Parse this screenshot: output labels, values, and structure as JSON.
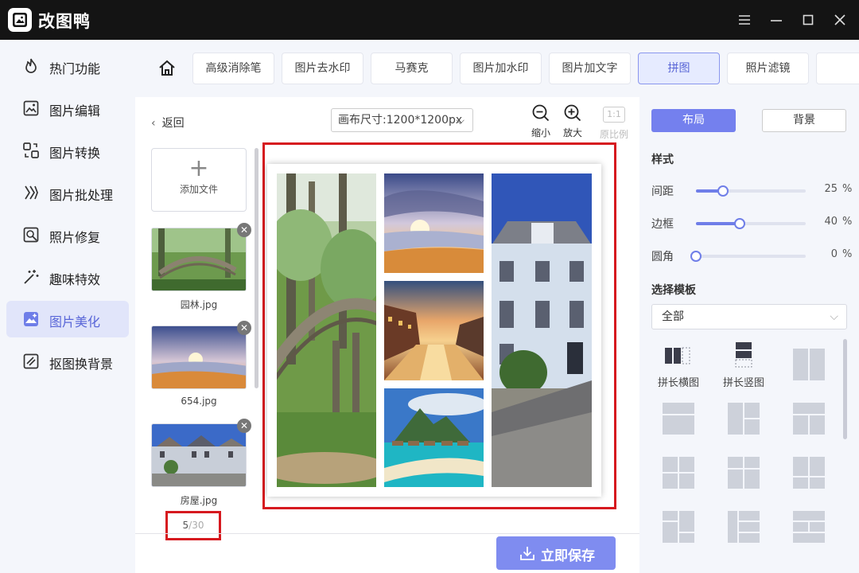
{
  "app": {
    "title": "改图鸭"
  },
  "sidebar": {
    "items": [
      {
        "label": "热门功能",
        "icon": "flame-icon"
      },
      {
        "label": "图片编辑",
        "icon": "image-edit-icon"
      },
      {
        "label": "图片转换",
        "icon": "convert-icon"
      },
      {
        "label": "图片批处理",
        "icon": "batch-icon"
      },
      {
        "label": "照片修复",
        "icon": "photo-repair-icon"
      },
      {
        "label": "趣味特效",
        "icon": "magic-wand-icon"
      },
      {
        "label": "图片美化",
        "icon": "beautify-icon",
        "active": true
      },
      {
        "label": "抠图换背景",
        "icon": "cutout-icon"
      }
    ]
  },
  "toolbar": {
    "tabs": [
      "高级消除笔",
      "图片去水印",
      "马赛克",
      "图片加水印",
      "图片加文字",
      "拼图",
      "照片滤镜"
    ],
    "active_tab": "拼图"
  },
  "workspace": {
    "back_label": "返回",
    "canvas_size": "画布尺寸:1200*1200px",
    "zoom_out_label": "缩小",
    "zoom_in_label": "放大",
    "ratio_badge": "1:1",
    "ratio_label": "原比例",
    "add_file_label": "添加文件",
    "files": [
      {
        "name": "园林.jpg"
      },
      {
        "name": "654.jpg"
      },
      {
        "name": "房屋.jpg"
      }
    ],
    "counter_current": "5",
    "counter_total": "/30",
    "save_label": "立即保存"
  },
  "right_panel": {
    "tabs": [
      "布局",
      "背景"
    ],
    "style_title": "样式",
    "sliders": [
      {
        "label": "间距",
        "value": "25",
        "unit": "%",
        "fraction": 0.25
      },
      {
        "label": "边框",
        "value": "40",
        "unit": "%",
        "fraction": 0.4
      },
      {
        "label": "圆角",
        "value": "0",
        "unit": "%",
        "fraction": 0
      }
    ],
    "template_title": "选择模板",
    "template_filter": "全部",
    "template_captions": [
      "拼长横图",
      "拼长竖图"
    ]
  },
  "colors": {
    "accent": "#7480ee",
    "highlight": "#d6191f",
    "titlebar": "#141414"
  }
}
